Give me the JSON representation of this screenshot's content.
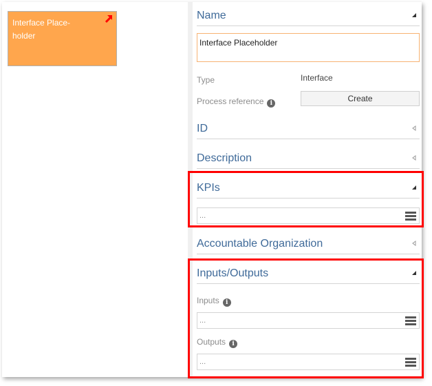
{
  "canvas": {
    "shape": {
      "label": "Interface Place-holder",
      "fill_color": "#FFA64D",
      "icon": "interface-arrow-icon"
    }
  },
  "panel": {
    "name_section": {
      "title": "Name",
      "expanded": true,
      "value": "Interface Placeholder"
    },
    "type": {
      "label": "Type",
      "value": "Interface"
    },
    "process_reference": {
      "label": "Process reference",
      "button_label": "Create",
      "info_icon": "info-icon"
    },
    "id_section": {
      "title": "ID",
      "expanded": false
    },
    "description_section": {
      "title": "Description",
      "expanded": false
    },
    "kpis_section": {
      "title": "KPIs",
      "expanded": true,
      "field_placeholder": "...",
      "menu_icon": "hamburger-icon"
    },
    "accountable_org_section": {
      "title": "Accountable Organization",
      "expanded": false
    },
    "inputs_outputs_section": {
      "title": "Inputs/Outputs",
      "expanded": true,
      "inputs": {
        "label": "Inputs",
        "placeholder": "..."
      },
      "outputs": {
        "label": "Outputs",
        "placeholder": "..."
      }
    }
  },
  "highlight_color": "#FF0000"
}
